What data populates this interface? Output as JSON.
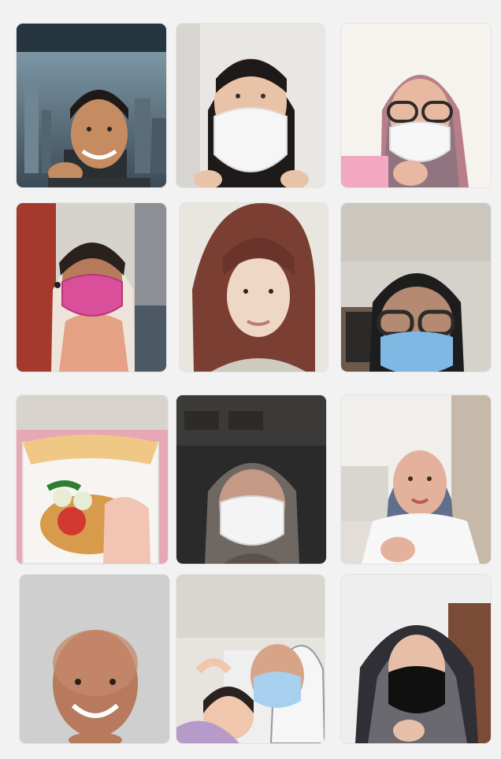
{
  "app": {
    "background": "#f2f2f2"
  },
  "grid": {
    "rows": 4,
    "columns": 3
  },
  "participants": [
    {
      "id": "p1",
      "scene": "man-city-window",
      "accent": "#2b3f4f"
    },
    {
      "id": "p2",
      "scene": "woman-white-mask",
      "accent": "#f3f3f3"
    },
    {
      "id": "p3",
      "scene": "woman-glasses-floral-hijab",
      "accent": "#e9a6bf"
    },
    {
      "id": "p4",
      "scene": "woman-pink-mask-hijab",
      "accent": "#d95aa8"
    },
    {
      "id": "p5",
      "scene": "woman-long-hair",
      "accent": "#7a3e32"
    },
    {
      "id": "p6",
      "scene": "woman-glasses-blue-mask",
      "accent": "#7fb9e3"
    },
    {
      "id": "p7",
      "scene": "food-box",
      "accent": "#e3b04f"
    },
    {
      "id": "p8",
      "scene": "woman-white-mask-dark-room",
      "accent": "#2a2a2a"
    },
    {
      "id": "p9",
      "scene": "woman-doctor-hijab",
      "accent": "#5f6f8c"
    },
    {
      "id": "p10",
      "scene": "bald-man-smiling",
      "accent": "#c7c7c7"
    },
    {
      "id": "p11",
      "scene": "mother-and-child",
      "accent": "#d8d8d8"
    },
    {
      "id": "p12",
      "scene": "woman-black-mask",
      "accent": "#111111"
    }
  ]
}
